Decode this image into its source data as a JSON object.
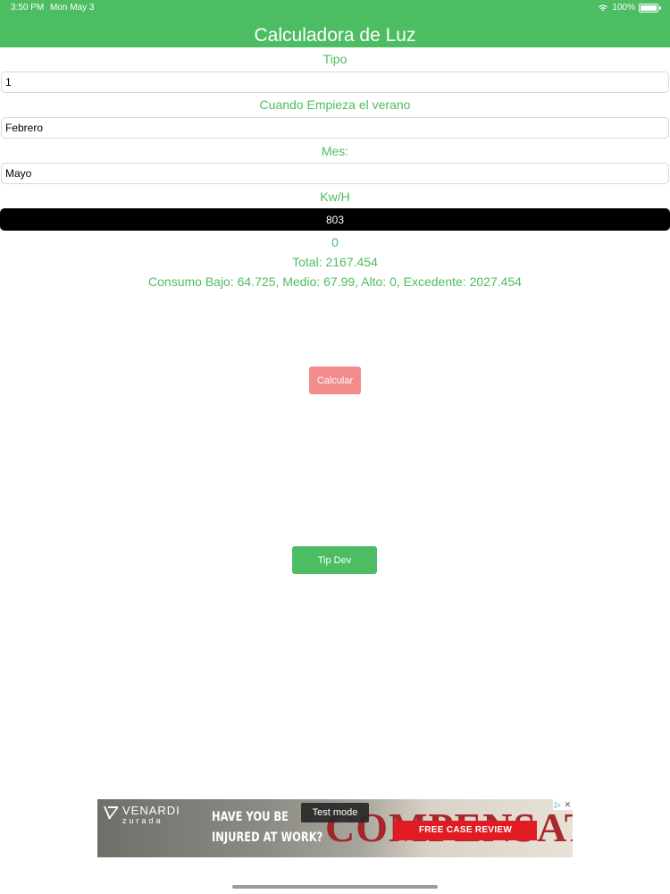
{
  "status_bar": {
    "time": "3:50 PM",
    "date": "Mon May 3",
    "battery_level": "100%",
    "wifi_icon": "wifi-icon",
    "battery_icon": "battery-icon"
  },
  "header": {
    "title": "Calculadora de Luz",
    "color": "#4cbd62"
  },
  "form": {
    "tipo": {
      "label": "Tipo",
      "value": "1"
    },
    "verano": {
      "label": "Cuando Empieza el verano",
      "value": "Febrero"
    },
    "mes": {
      "label": "Mes:",
      "value": "Mayo"
    },
    "kwh": {
      "label": "Kw/H",
      "value": "803"
    }
  },
  "results": {
    "value": "0",
    "total": "Total: 2167.454",
    "breakdown": "Consumo Bajo: 64.725, Medio: 67.99, Alto: 0, Excedente: 2027.454"
  },
  "buttons": {
    "calcular": "Calcular",
    "tip_dev": "Tip Dev",
    "calcular_color": "#f28b8b",
    "tip_color": "#4cbd62"
  },
  "ad": {
    "brand": "VENARDI",
    "brand_sub": "zurada",
    "headline_line1": "HAVE YOU BE",
    "headline_line2": "INJURED AT WORK?",
    "background_word": "COMPENSATION",
    "cta": "FREE CASE REVIEW",
    "test_mode": "Test mode",
    "choices_icon": "ad-choices-icon",
    "close_icon": "close-icon"
  }
}
